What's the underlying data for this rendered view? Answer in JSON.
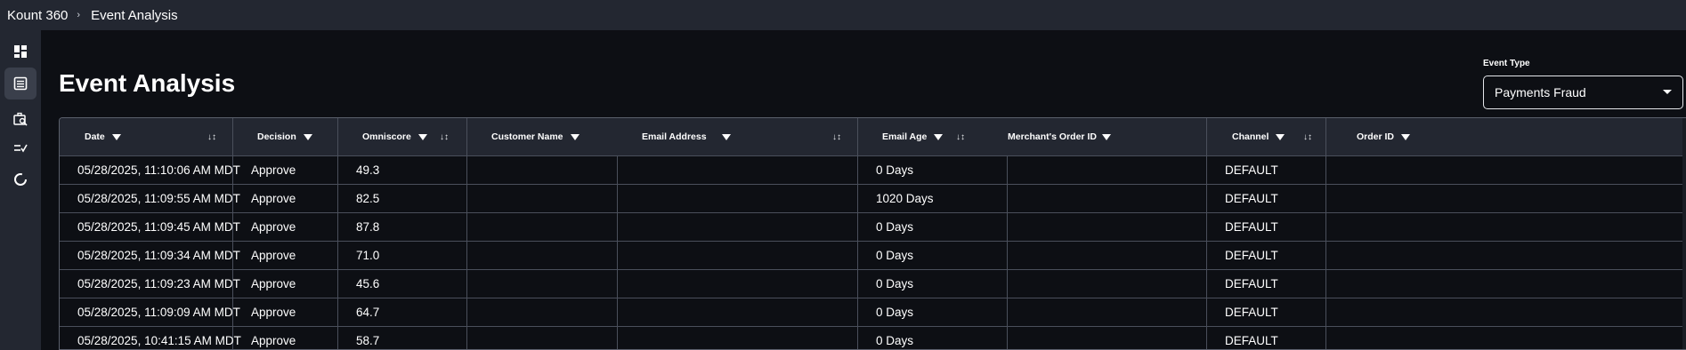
{
  "breadcrumb": {
    "root": "Kount 360",
    "current": "Event Analysis"
  },
  "page": {
    "title": "Event Analysis"
  },
  "event_type": {
    "label": "Event Type",
    "value": "Payments Fraud"
  },
  "sidebar": {
    "items": [
      {
        "icon": "dashboard-icon",
        "active": false
      },
      {
        "icon": "list-icon",
        "active": true
      },
      {
        "icon": "case-search-icon",
        "active": false
      },
      {
        "icon": "rules-icon",
        "active": false
      },
      {
        "icon": "loading-circle-icon",
        "active": false
      }
    ]
  },
  "table": {
    "columns": [
      "Date",
      "Decision",
      "Omniscore",
      "Customer Name",
      "Email Address",
      "Email Age",
      "Merchant's Order ID",
      "Channel",
      "Order ID"
    ],
    "rows": [
      {
        "date": "05/28/2025, 11:10:06 AM MDT",
        "decision": "Approve",
        "omniscore": "49.3",
        "customer": "",
        "email": "",
        "email_age": "0 Days",
        "merchant_order": "",
        "channel": "DEFAULT",
        "order_id": ""
      },
      {
        "date": "05/28/2025, 11:09:55 AM MDT",
        "decision": "Approve",
        "omniscore": "82.5",
        "customer": "",
        "email": "",
        "email_age": "1020 Days",
        "merchant_order": "",
        "channel": "DEFAULT",
        "order_id": ""
      },
      {
        "date": "05/28/2025, 11:09:45 AM MDT",
        "decision": "Approve",
        "omniscore": "87.8",
        "customer": "",
        "email": "",
        "email_age": "0 Days",
        "merchant_order": "",
        "channel": "DEFAULT",
        "order_id": ""
      },
      {
        "date": "05/28/2025, 11:09:34 AM MDT",
        "decision": "Approve",
        "omniscore": "71.0",
        "customer": "",
        "email": "",
        "email_age": "0 Days",
        "merchant_order": "",
        "channel": "DEFAULT",
        "order_id": ""
      },
      {
        "date": "05/28/2025, 11:09:23 AM MDT",
        "decision": "Approve",
        "omniscore": "45.6",
        "customer": "",
        "email": "",
        "email_age": "0 Days",
        "merchant_order": "",
        "channel": "DEFAULT",
        "order_id": ""
      },
      {
        "date": "05/28/2025, 11:09:09 AM MDT",
        "decision": "Approve",
        "omniscore": "64.7",
        "customer": "",
        "email": "",
        "email_age": "0 Days",
        "merchant_order": "",
        "channel": "DEFAULT",
        "order_id": ""
      },
      {
        "date": "05/28/2025, 10:41:15 AM MDT",
        "decision": "Approve",
        "omniscore": "58.7",
        "customer": "",
        "email": "",
        "email_age": "0 Days",
        "merchant_order": "",
        "channel": "DEFAULT",
        "order_id": ""
      }
    ]
  }
}
